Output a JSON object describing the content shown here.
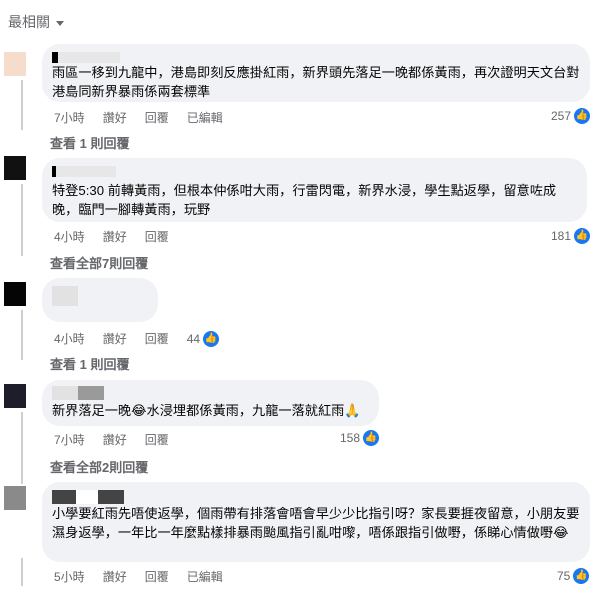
{
  "sort": {
    "label": "最相關"
  },
  "comments": [
    {
      "text": "雨區一移到九龍中，港島即刻反應掛紅雨，新界頭先落足一晚都係黃雨，再次證明天文台對港島同新界暴雨係兩套標準",
      "time": "7小時",
      "like": "讚好",
      "reply": "回覆",
      "edited": "已編輯",
      "reactions": "257",
      "view_replies": "查看 1 則回覆",
      "avatar_color": "#f6dccb"
    },
    {
      "text": "特登5:30 前轉黃雨，但根本仲係咁大雨，行雷閃電，新界水浸，學生點返學，留意咗成晚，臨門一腳轉黃雨，玩野",
      "time": "4小時",
      "like": "讚好",
      "reply": "回覆",
      "reactions": "181",
      "view_replies": "查看全部7則回覆",
      "avatar_color": "#111111"
    },
    {
      "text": "",
      "time": "4小時",
      "like": "讚好",
      "reply": "回覆",
      "reactions": "44",
      "view_replies": "查看 1 則回覆",
      "avatar_color": "#050505"
    },
    {
      "text": "新界落足一晚😂水浸埋都係黃雨，九龍一落就紅雨🙏",
      "time": "7小時",
      "like": "讚好",
      "reply": "回覆",
      "reactions": "158",
      "view_replies": "查看全部2則回覆",
      "avatar_color": "#1e1e2a"
    },
    {
      "text": "小學要紅雨先唔使返學，個雨帶有排落會唔會早少少比指引呀？家長要捱夜留意，小朋友要濕身返學，一年比一年麼點樣排暴雨颱風指引亂咁嚟，唔係跟指引做嘢，係睇心情做嘢😂",
      "time": "5小時",
      "like": "讚好",
      "reply": "回覆",
      "edited": "已編輯",
      "reactions": "75",
      "avatar_color": "#8a8a8a"
    }
  ],
  "colors": {
    "bubble": "#f0f2f5",
    "meta": "#65676b",
    "like": "#1877f2"
  },
  "icons": {
    "like": "like-thumb-icon",
    "sort": "chevron-down-icon"
  }
}
